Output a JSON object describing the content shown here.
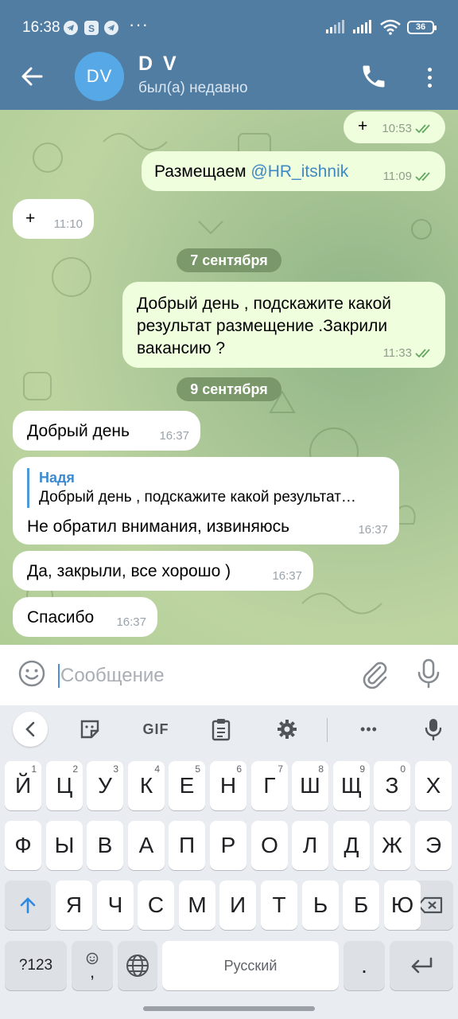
{
  "status_bar": {
    "time": "16:38",
    "dots": "···",
    "battery": "36",
    "notification_icons": [
      "telegram-icon",
      "skype-icon",
      "telegram-icon"
    ]
  },
  "header": {
    "avatar_initials": "DV",
    "contact_name": "D V",
    "contact_status": "был(а) недавно",
    "accent": "#517da2"
  },
  "messages": {
    "m1": {
      "direction": "out",
      "text": "+",
      "time": "10:53"
    },
    "m2": {
      "direction": "out",
      "text": "Размещаем ",
      "mention": "@HR_itshnik",
      "time": "11:09"
    },
    "m3": {
      "direction": "in",
      "text": "+",
      "time": "11:10"
    },
    "date1": "7 сентября",
    "m4": {
      "direction": "out",
      "lines": [
        "Добрый день , подскажите какой",
        "результат размещение .Закрили",
        "вакансию ?"
      ],
      "time": "11:33"
    },
    "date2": "9 сентября",
    "m5": {
      "direction": "in",
      "text": "Добрый день",
      "time": "16:37"
    },
    "m6": {
      "direction": "in",
      "reply_name": "Надя",
      "reply_text": "Добрый день , подскажите какой результат…",
      "text": "Не обратил внимания, извиняюсь",
      "time": "16:37"
    },
    "m7": {
      "direction": "in",
      "text": "Да, закрыли, все хорошо )",
      "time": "16:37"
    },
    "m8": {
      "direction": "in",
      "text": "Спасибо",
      "time": "16:37"
    }
  },
  "input": {
    "placeholder": "Сообщение"
  },
  "keyboard": {
    "toolbar": [
      "back-chevron",
      "sticker",
      "GIF",
      "clipboard",
      "settings",
      "more",
      "voice"
    ],
    "gif_label": "GIF",
    "more_label": "•••",
    "row1": [
      {
        "k": "Й",
        "h": "1"
      },
      {
        "k": "Ц",
        "h": "2"
      },
      {
        "k": "У",
        "h": "3"
      },
      {
        "k": "К",
        "h": "4"
      },
      {
        "k": "Е",
        "h": "5"
      },
      {
        "k": "Н",
        "h": "6"
      },
      {
        "k": "Г",
        "h": "7"
      },
      {
        "k": "Ш",
        "h": "8"
      },
      {
        "k": "Щ",
        "h": "9"
      },
      {
        "k": "З",
        "h": "0"
      },
      {
        "k": "Х",
        "h": ""
      }
    ],
    "row2": [
      "Ф",
      "Ы",
      "В",
      "А",
      "П",
      "Р",
      "О",
      "Л",
      "Д",
      "Ж",
      "Э"
    ],
    "row3": [
      "Я",
      "Ч",
      "С",
      "М",
      "И",
      "Т",
      "Ь",
      "Б",
      "Ю"
    ],
    "symbols_label": "?123",
    "emoji_comma": ",",
    "space_label": "Русский",
    "period": "."
  }
}
